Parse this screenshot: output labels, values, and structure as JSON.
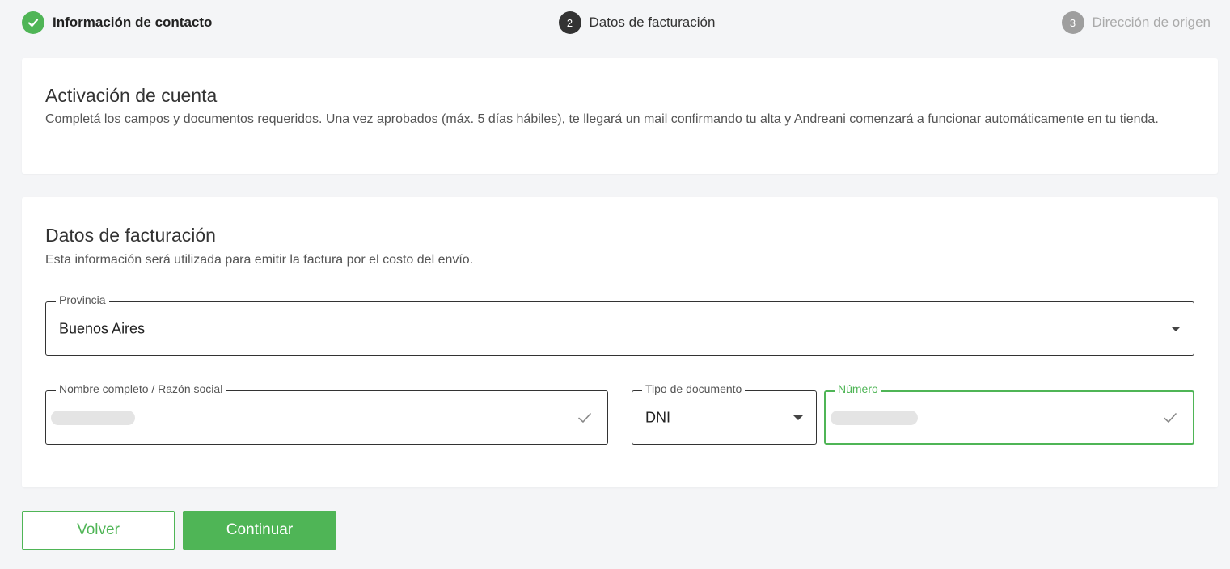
{
  "stepper": {
    "steps": [
      {
        "number": "1",
        "label": "Información de contacto",
        "state": "done"
      },
      {
        "number": "2",
        "label": "Datos de facturación",
        "state": "active"
      },
      {
        "number": "3",
        "label": "Dirección de origen",
        "state": "pending"
      }
    ]
  },
  "activation": {
    "title": "Activación de cuenta",
    "description": "Completá los campos y documentos requeridos. Una vez aprobados (máx. 5 días hábiles), te llegará un mail confirmando tu alta y Andreani comenzará a funcionar automáticamente en tu tienda."
  },
  "billing": {
    "title": "Datos de facturación",
    "description": "Esta información será utilizada para emitir la factura por el costo del envío.",
    "province": {
      "label": "Provincia",
      "value": "Buenos Aires"
    },
    "full_name": {
      "label": "Nombre completo / Razón social",
      "value": ""
    },
    "document_type": {
      "label": "Tipo de documento",
      "value": "DNI"
    },
    "number": {
      "label": "Número",
      "value": ""
    }
  },
  "actions": {
    "back_label": "Volver",
    "continue_label": "Continuar"
  },
  "colors": {
    "accent": "#4fb556",
    "active_step": "#333333",
    "pending_step": "#9e9e9e",
    "background": "#f4f5f7"
  }
}
